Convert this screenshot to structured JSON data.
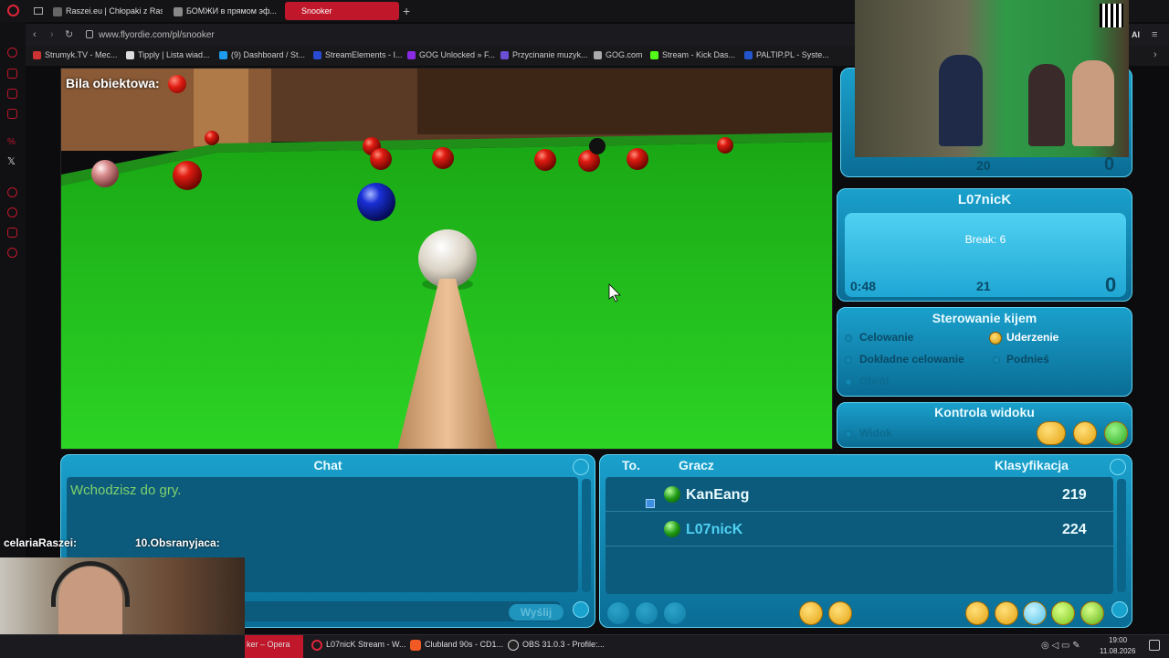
{
  "browser": {
    "tabs": [
      "Raszei.eu | Chłopaki z Ras...",
      "БОМЖИ в прямом эф...",
      "Snooker"
    ],
    "address": "www.flyordie.com/pl/snooker",
    "bookmarks": [
      "Strumyk.TV - Mec...",
      "Tipply | Lista wiad...",
      "(9) Dashboard / St...",
      "StreamElements - I...",
      "GOG Unlocked » F...",
      "Przycinanie muzyk...",
      "GOG.com",
      "Stream - Kick Das...",
      "PALTIP.PL - Syste..."
    ],
    "ai_label": "AI"
  },
  "game": {
    "object_ball_label": "Bila obiektowa:",
    "top_score": {
      "left": "20",
      "right": "0"
    },
    "player_panel": {
      "name": "L07nicK",
      "break_text": "Break: 6",
      "timer": "0:48",
      "points": "21",
      "score": "0"
    },
    "cue_control": {
      "title": "Sterowanie kijem",
      "options": [
        "Celowanie",
        "Uderzenie",
        "Dokładne celowanie",
        "Podnieś",
        "Obrót"
      ],
      "selected": "Uderzenie"
    },
    "view_control": {
      "title": "Kontrola widoku",
      "option": "Widok"
    },
    "chat": {
      "title": "Chat",
      "message": "Wchodzisz do gry.",
      "send_label": "Wyślij"
    },
    "players": {
      "headers": [
        "To.",
        "Gracz",
        "Klasyfikacja"
      ],
      "rows": [
        {
          "name": "KanEang",
          "rating": "219"
        },
        {
          "name": "L07nicK",
          "rating": "224"
        }
      ]
    }
  },
  "overlay": {
    "ticker": [
      {
        "text": "celariaRaszei:"
      },
      {
        "text": "10.Obsranyjaca:"
      }
    ]
  },
  "taskbar": {
    "items": [
      "ker – Opera",
      "L07nicK Stream - W...",
      "Clubland 90s - CD1...",
      "OBS 31.0.3 - Profile:..."
    ],
    "time": "19:00",
    "date": "11.08.2026"
  },
  "colors": {
    "accent": "#c0172b",
    "table_felt": "#22c21a",
    "panel": "#1aa0cc"
  }
}
